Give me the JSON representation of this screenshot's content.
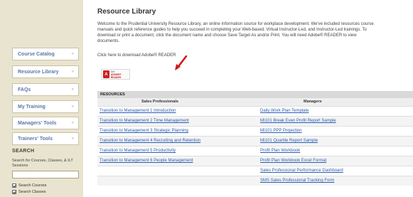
{
  "sidebar": {
    "nav": [
      {
        "label": "Course Catalog",
        "chevron": "»"
      },
      {
        "label": "Resource Library",
        "chevron": "»"
      },
      {
        "label": "FAQs",
        "chevron": "»"
      },
      {
        "label": "My Training",
        "chevron": "»"
      },
      {
        "label": "Managers' Tools",
        "chevron": "»"
      },
      {
        "label": "Trainers' Tools",
        "chevron": "»"
      }
    ],
    "search": {
      "title": "SEARCH",
      "hint": "Search for Courses, Classes, & ILT Sessions",
      "input_value": "",
      "options": [
        {
          "label": "Search Courses",
          "checked": true
        },
        {
          "label": "Search Classes",
          "checked": true
        }
      ]
    }
  },
  "main": {
    "title": "Resource Library",
    "intro": "Welcome to the Prudential University Resource Library, an online information source for workplace development. We've included resources course manuals and quick reference guides to help you succeed in completing your Web-based, Virtual Instructor-Led, and Instructor-Led trainings. To download or print a document, click the document name and choose Save Target As and/or Print. You will need Adobe® READER to view documents.",
    "download_text": "Click here to download Adobe® READER",
    "adobe_badge": {
      "icon": "A",
      "line1": "Get",
      "line2": "ADOBE® READER"
    },
    "accent_color": "#2a5db0"
  },
  "resources": {
    "header": "RESOURCES",
    "columns": [
      "Sales Professionals",
      "Managers"
    ],
    "rows": [
      [
        "Transition to Management 1 Introduction",
        "Daily Work Plan Template"
      ],
      [
        "Transition to Management 2 Time Management",
        "MI101 Break Even Profit Report Sample"
      ],
      [
        "Transition to Management 3 Strategic Planning",
        "MI101 PPP Projection"
      ],
      [
        "Transition to Management 4 Recruiting and Retention",
        "MI101 Quartile Report Sample"
      ],
      [
        "Transition to Management 5 Productivity",
        "Profit Plan Workbook"
      ],
      [
        "Transition to Management 6 People Management",
        "Profit Plan Workbook Excel Format"
      ],
      [
        "",
        "Sales Professional Performance Dashboard"
      ],
      [
        "",
        "SMS Sales Professional Tracking Form"
      ]
    ]
  }
}
